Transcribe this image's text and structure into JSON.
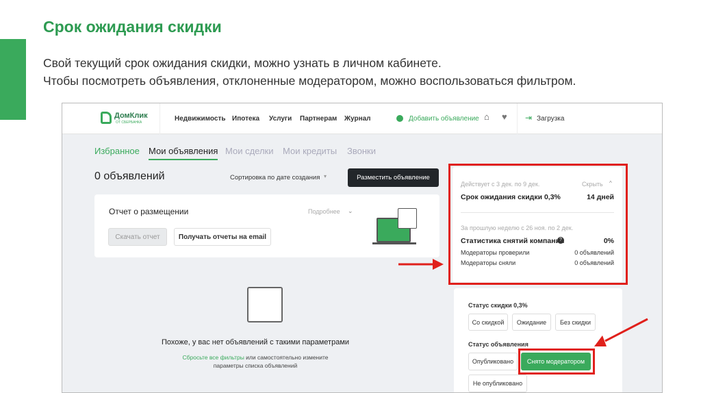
{
  "slide": {
    "title": "Срок ожидания скидки",
    "lines": [
      "Свой текущий срок ожидания скидки, можно узнать в личном кабинете.",
      "Чтобы посмотреть объявления, отклоненные модератором, можно воспользоваться фильтром."
    ]
  },
  "header": {
    "logo": "ДомКлик",
    "logo_sub": "ОТ СБЕРБАНКА",
    "nav": [
      "Недвижимость",
      "Ипотека",
      "Услуги",
      "Партнерам",
      "Журнал"
    ],
    "add": "Добавить объявление",
    "upload": "Загрузка"
  },
  "tabs": [
    "Избранное",
    "Мои объявления",
    "Мои сделки",
    "Мои кредиты",
    "Звонки"
  ],
  "main": {
    "count": "0 объявлений",
    "sort": "Сортировка по дате создания",
    "place": "Разместить объявление"
  },
  "report": {
    "title": "Отчет о размещении",
    "more": "Подробнее",
    "download": "Скачать отчет",
    "email": "Получать отчеты на email"
  },
  "empty": {
    "title": "Похоже, у вас нет объявлений с такими параметрами",
    "reset": "Сбросьте все фильтры",
    "rest1": " или самостоятельно измените",
    "rest2": "параметры списка объявлений"
  },
  "discount": {
    "period": "Действует с 3 дек. по 9 дек.",
    "hide": "Скрыть",
    "label": "Срок ожидания скидки 0,3%",
    "value": "14 дней",
    "week": "За прошлую неделю с 26 ноя. по 2 дек.",
    "stat": "Статистика снятий компании",
    "stat_value": "0%",
    "checked": "Модераторы проверили",
    "checked_value": "0 объявлений",
    "removed": "Модераторы сняли",
    "removed_value": "0 объявлений"
  },
  "filters": {
    "discount_title": "Статус скидки 0,3%",
    "discount_opts": [
      "Со скидкой",
      "Ожидание",
      "Без скидки"
    ],
    "status_title": "Статус объявления",
    "status_opts": [
      "Опубликовано",
      "Снято модератором",
      "Не опубликовано"
    ]
  },
  "colors": {
    "green": "#3aaa5c",
    "red": "#e0201b"
  }
}
